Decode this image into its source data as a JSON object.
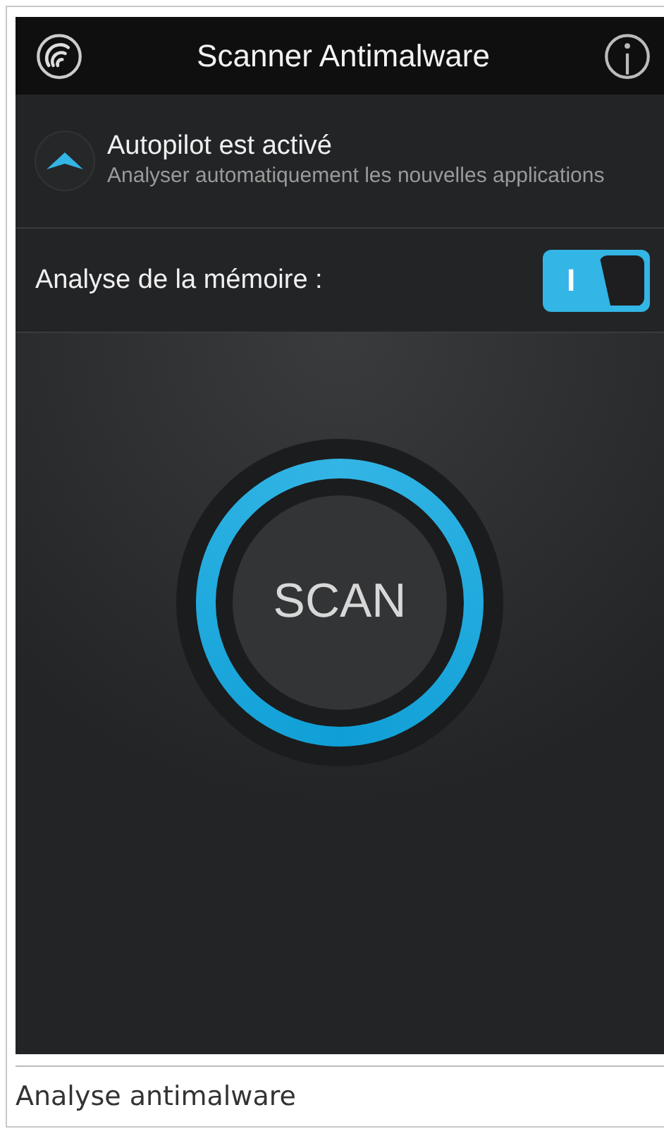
{
  "app_bar": {
    "title": "Scanner Antimalware"
  },
  "autopilot": {
    "title": "Autopilot est activé",
    "subtitle": "Analyser automatiquement les nouvelles applications"
  },
  "memory_scan": {
    "label": "Analyse de la mémoire :",
    "toggle_label": "I",
    "on": true
  },
  "scan_button": {
    "label": "SCAN"
  },
  "caption": "Analyse antimalware"
}
